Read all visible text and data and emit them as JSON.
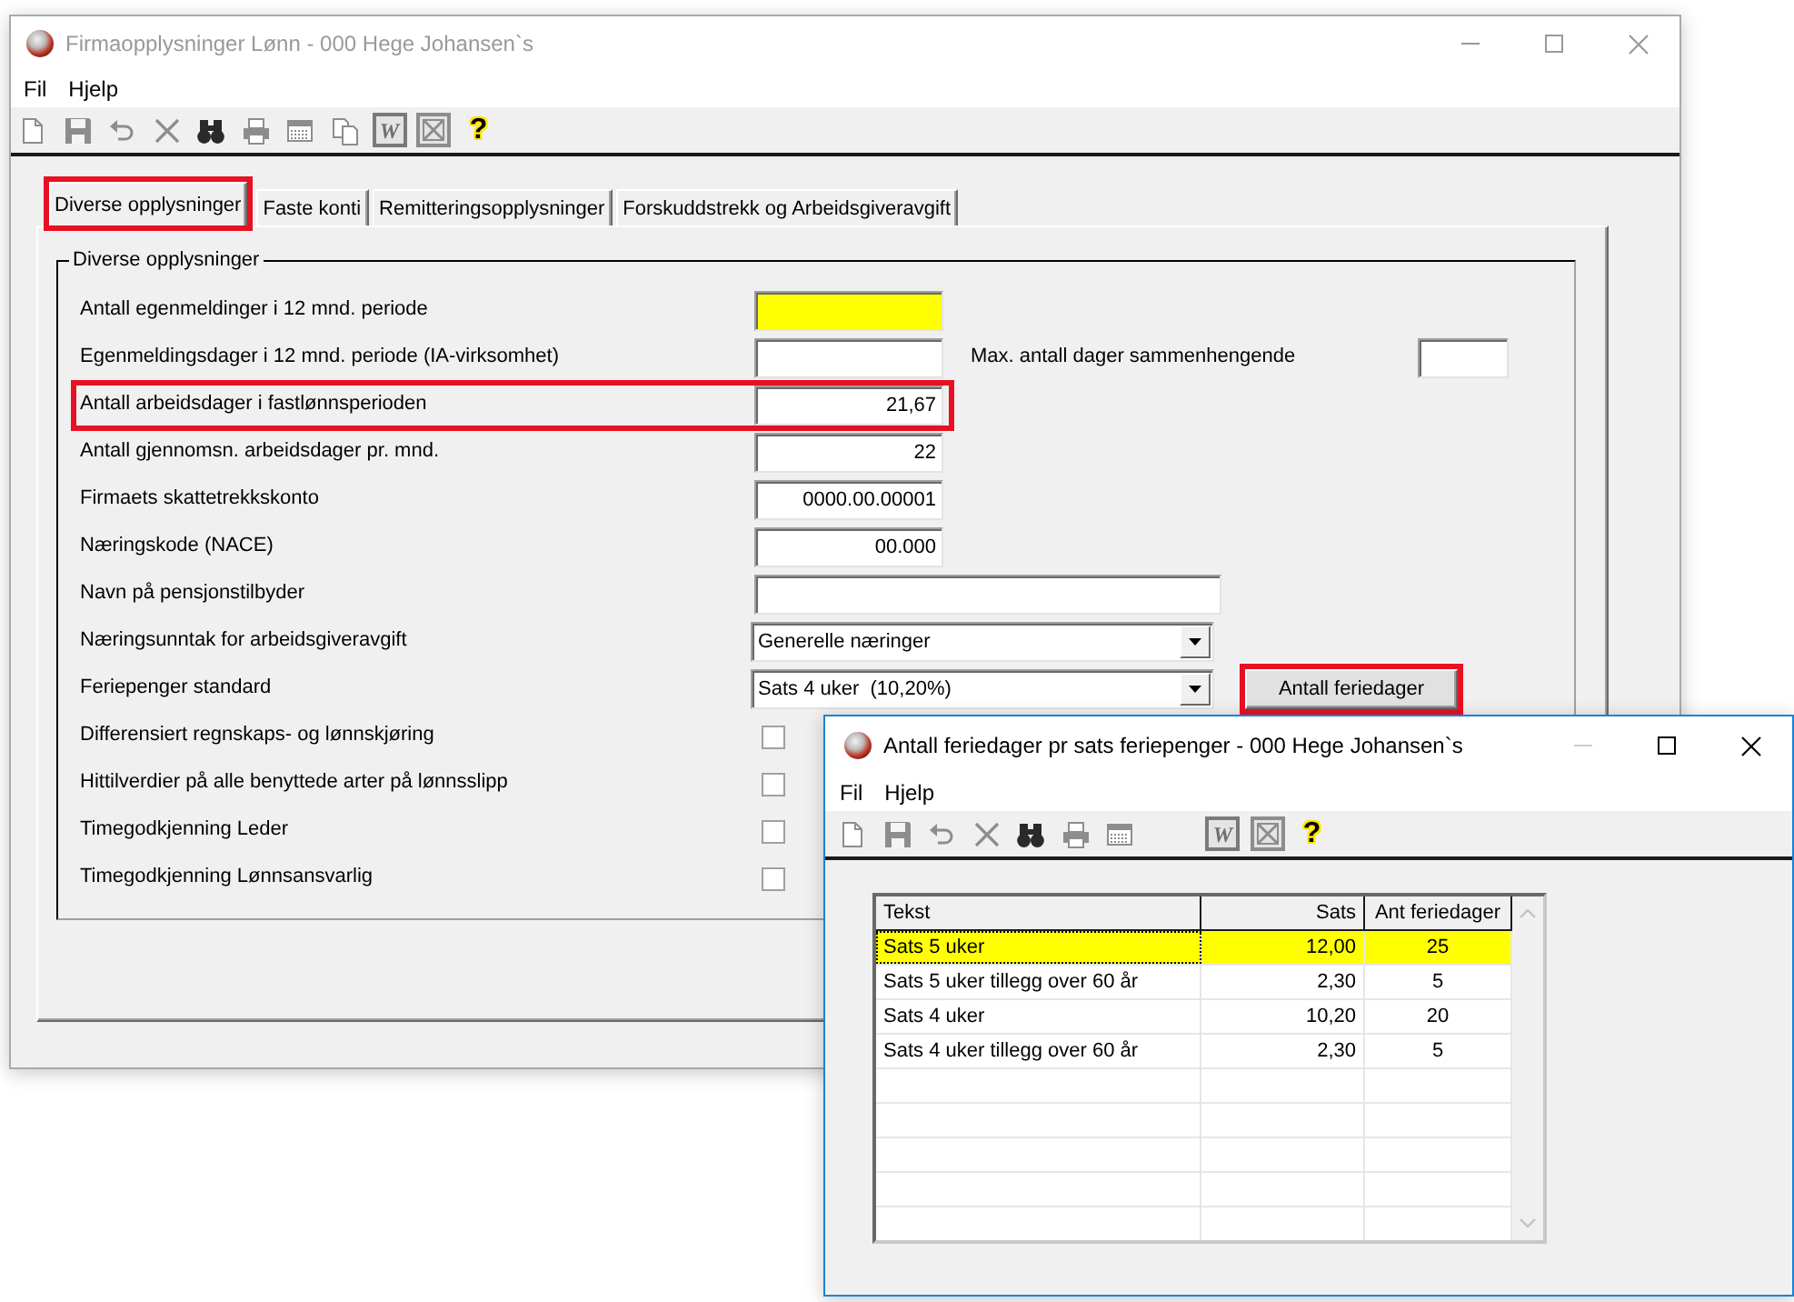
{
  "main_window": {
    "title": "Firmaopplysninger Lønn - 000 Hege Johansen`s",
    "active": false,
    "minimize_disabled": false,
    "menu": [
      "Fil",
      "Hjelp"
    ],
    "toolbar": [
      {
        "kind": "new",
        "disabled": true
      },
      {
        "kind": "save",
        "disabled": true
      },
      {
        "kind": "undo",
        "disabled": true
      },
      {
        "kind": "delete",
        "disabled": true
      },
      {
        "kind": "find",
        "disabled": false
      },
      {
        "kind": "print",
        "disabled": true
      },
      {
        "kind": "calendar",
        "disabled": true
      },
      {
        "kind": "copy",
        "disabled": true
      },
      {
        "kind": "word",
        "glyph": "W",
        "disabled": true
      },
      {
        "kind": "excel",
        "disabled": true
      },
      {
        "kind": "help",
        "glyph": "?",
        "disabled": false
      }
    ],
    "tabs": [
      {
        "label": "Diverse opplysninger",
        "selected": true,
        "highlighted": true
      },
      {
        "label": "Faste konti",
        "selected": false,
        "highlighted": false
      },
      {
        "label": "Remitteringsopplysninger",
        "selected": false,
        "highlighted": false
      },
      {
        "label": "Forskuddstrekk og Arbeidsgiveravgift",
        "selected": false,
        "highlighted": false
      }
    ],
    "group": {
      "title": "Diverse opplysninger",
      "rows": [
        {
          "kind": "text",
          "label": "Antall egenmeldinger i 12 mnd. periode",
          "focused": true,
          "highlighted": false
        },
        {
          "kind": "text",
          "label": "Egenmeldingsdager i 12 mnd. periode (IA-virksomhet)",
          "focused": false,
          "highlighted": false,
          "side_field": {
            "label": "Max. antall dager sammenhengende"
          }
        },
        {
          "kind": "text",
          "label": "Antall arbeidsdager i fastlønnsperioden",
          "value": "21,67",
          "focused": false,
          "highlighted": true
        },
        {
          "kind": "text",
          "label": "Antall gjennomsn. arbeidsdager pr. mnd.",
          "value": "22",
          "focused": false,
          "highlighted": false
        },
        {
          "kind": "text",
          "label": "Firmaets skattetrekkskonto",
          "value": "0000.00.00001",
          "focused": false,
          "highlighted": false
        },
        {
          "kind": "text",
          "label": "Næringskode (NACE)",
          "value": "00.000",
          "focused": false,
          "highlighted": false
        },
        {
          "kind": "longtext",
          "label": "Navn på pensjonstilbyder",
          "focused": false,
          "highlighted": false
        },
        {
          "kind": "combo",
          "label": "Næringsunntak for arbeidsgiveravgift",
          "value": "Generelle næringer",
          "highlighted": false
        },
        {
          "kind": "combo",
          "label": "Feriepenger standard",
          "value": "Sats 4 uker  (10,20%)",
          "highlighted": false,
          "button": {
            "label": "Antall feriedager",
            "highlighted": true
          }
        },
        {
          "kind": "checkbox",
          "label": "Differensiert regnskaps- og lønnskjøring",
          "checked": false,
          "highlighted": false
        },
        {
          "kind": "checkbox",
          "label": "Hittilverdier på alle benyttede arter på lønnsslipp",
          "checked": false,
          "highlighted": false
        },
        {
          "kind": "checkbox",
          "label": "Timegodkjenning Leder",
          "checked": false,
          "highlighted": false
        },
        {
          "kind": "checkbox",
          "label": "Timegodkjenning Lønnsansvarlig",
          "checked": false,
          "highlighted": false
        }
      ]
    }
  },
  "dialog": {
    "title": "Antall feriedager pr sats feriepenger - 000 Hege Johansen`s",
    "active": true,
    "minimize_disabled": true,
    "menu": [
      "Fil",
      "Hjelp"
    ],
    "toolbar": [
      {
        "kind": "new",
        "disabled": true
      },
      {
        "kind": "save",
        "disabled": true
      },
      {
        "kind": "undo",
        "disabled": true
      },
      {
        "kind": "delete",
        "disabled": true
      },
      {
        "kind": "find",
        "disabled": false
      },
      {
        "kind": "print",
        "disabled": true
      },
      {
        "kind": "calendar",
        "disabled": true
      },
      {
        "kind": "word",
        "glyph": "W",
        "disabled": true
      },
      {
        "kind": "excel",
        "disabled": true
      },
      {
        "kind": "help",
        "glyph": "?",
        "disabled": false
      }
    ],
    "table": {
      "columns": [
        "Tekst",
        "Sats",
        "Ant feriedager"
      ],
      "rows": [
        {
          "cells": [
            "Sats 5 uker",
            "12,00",
            "25"
          ],
          "selected": true
        },
        {
          "cells": [
            "Sats 5 uker tillegg over 60 år",
            "2,30",
            "5"
          ],
          "selected": false
        },
        {
          "cells": [
            "Sats 4 uker",
            "10,20",
            "20"
          ],
          "selected": false
        },
        {
          "cells": [
            "Sats 4 uker tillegg over 60 år",
            "2,30",
            "5"
          ],
          "selected": false
        }
      ]
    }
  }
}
